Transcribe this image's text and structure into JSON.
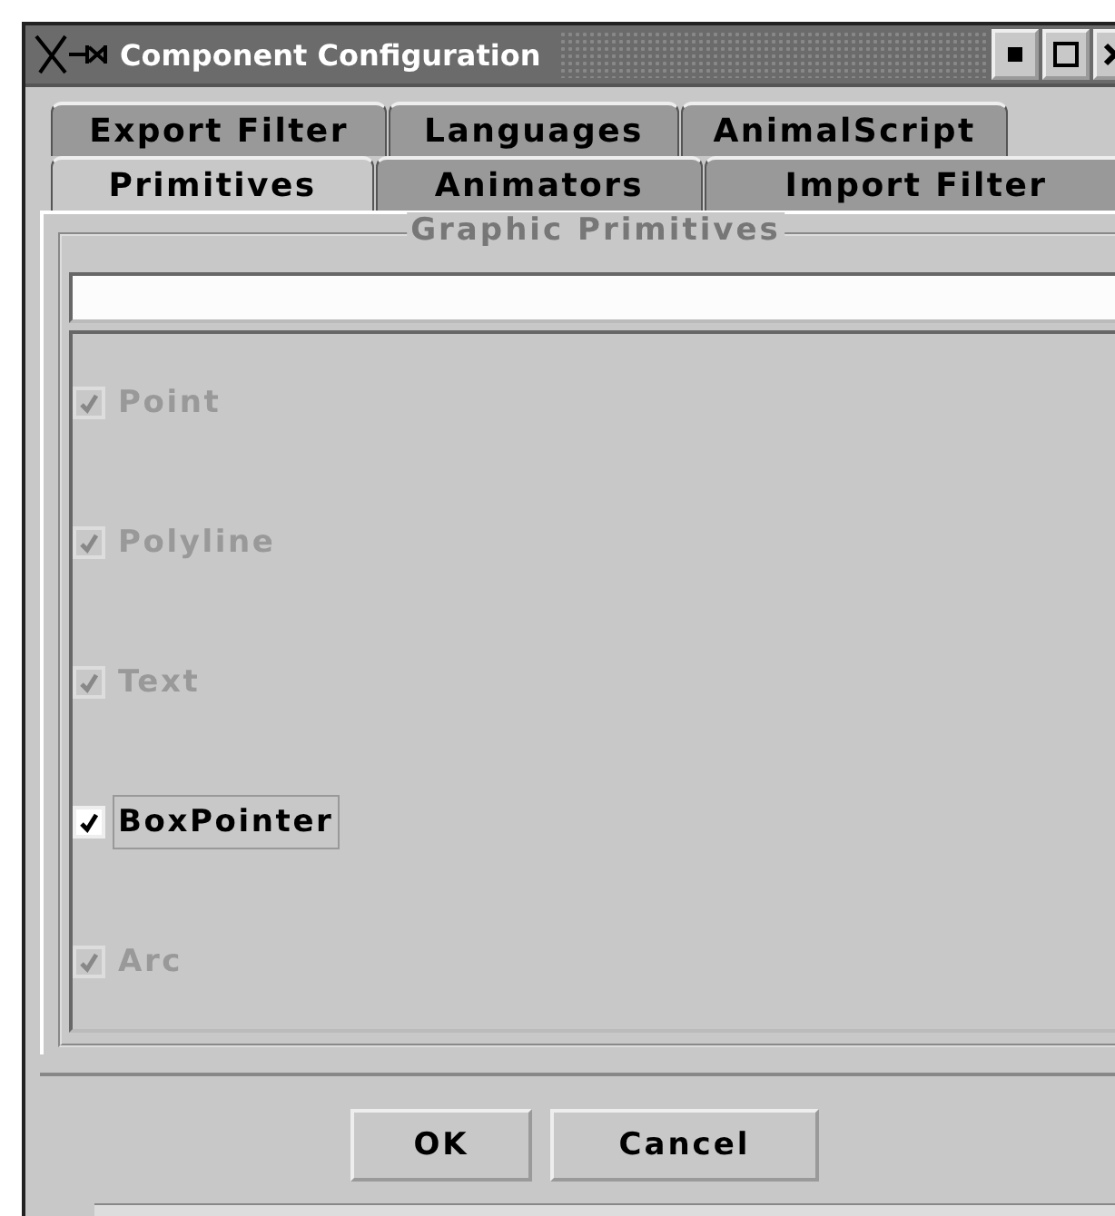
{
  "window": {
    "title": "Component Configuration"
  },
  "tab_rows": [
    [
      {
        "label": "Export Filter",
        "selected": false
      },
      {
        "label": "Languages",
        "selected": false
      },
      {
        "label": "AnimalScript",
        "selected": false
      }
    ],
    [
      {
        "label": "Primitives",
        "selected": true
      },
      {
        "label": "Animators",
        "selected": false
      },
      {
        "label": "Import Filter",
        "selected": false
      }
    ]
  ],
  "group": {
    "title": "Graphic Primitives",
    "items": [
      {
        "label": "Point",
        "checked": true,
        "disabled": true,
        "focused": false
      },
      {
        "label": "Polyline",
        "checked": true,
        "disabled": true,
        "focused": false
      },
      {
        "label": "Text",
        "checked": true,
        "disabled": true,
        "focused": false
      },
      {
        "label": "BoxPointer",
        "checked": true,
        "disabled": false,
        "focused": true
      },
      {
        "label": "Arc",
        "checked": true,
        "disabled": true,
        "focused": false
      }
    ]
  },
  "buttons": [
    "OK",
    "Cancel"
  ]
}
